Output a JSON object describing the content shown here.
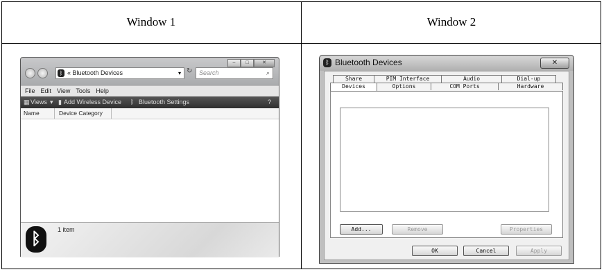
{
  "table": {
    "col1_heading": "Window 1",
    "col2_heading": "Window 2"
  },
  "window1": {
    "address_path": "« Bluetooth Devices",
    "search_placeholder": "Search",
    "menu": [
      "File",
      "Edit",
      "View",
      "Tools",
      "Help"
    ],
    "toolbar": {
      "views": "Views",
      "add_device": "Add Wireless Device",
      "settings": "Bluetooth Settings"
    },
    "columns": [
      "Name",
      "Device Category"
    ],
    "status_count": "1 item"
  },
  "window2": {
    "title": "Bluetooth Devices",
    "tabs_back": [
      "Share",
      "PIM Interface",
      "Audio",
      "Dial-up"
    ],
    "tabs_front": [
      "Devices",
      "Options",
      "COM Ports",
      "Hardware"
    ],
    "active_tab": "Devices",
    "buttons": {
      "add": "Add...",
      "remove": "Remove",
      "properties": "Properties",
      "ok": "OK",
      "cancel": "Cancel",
      "apply": "Apply"
    }
  }
}
